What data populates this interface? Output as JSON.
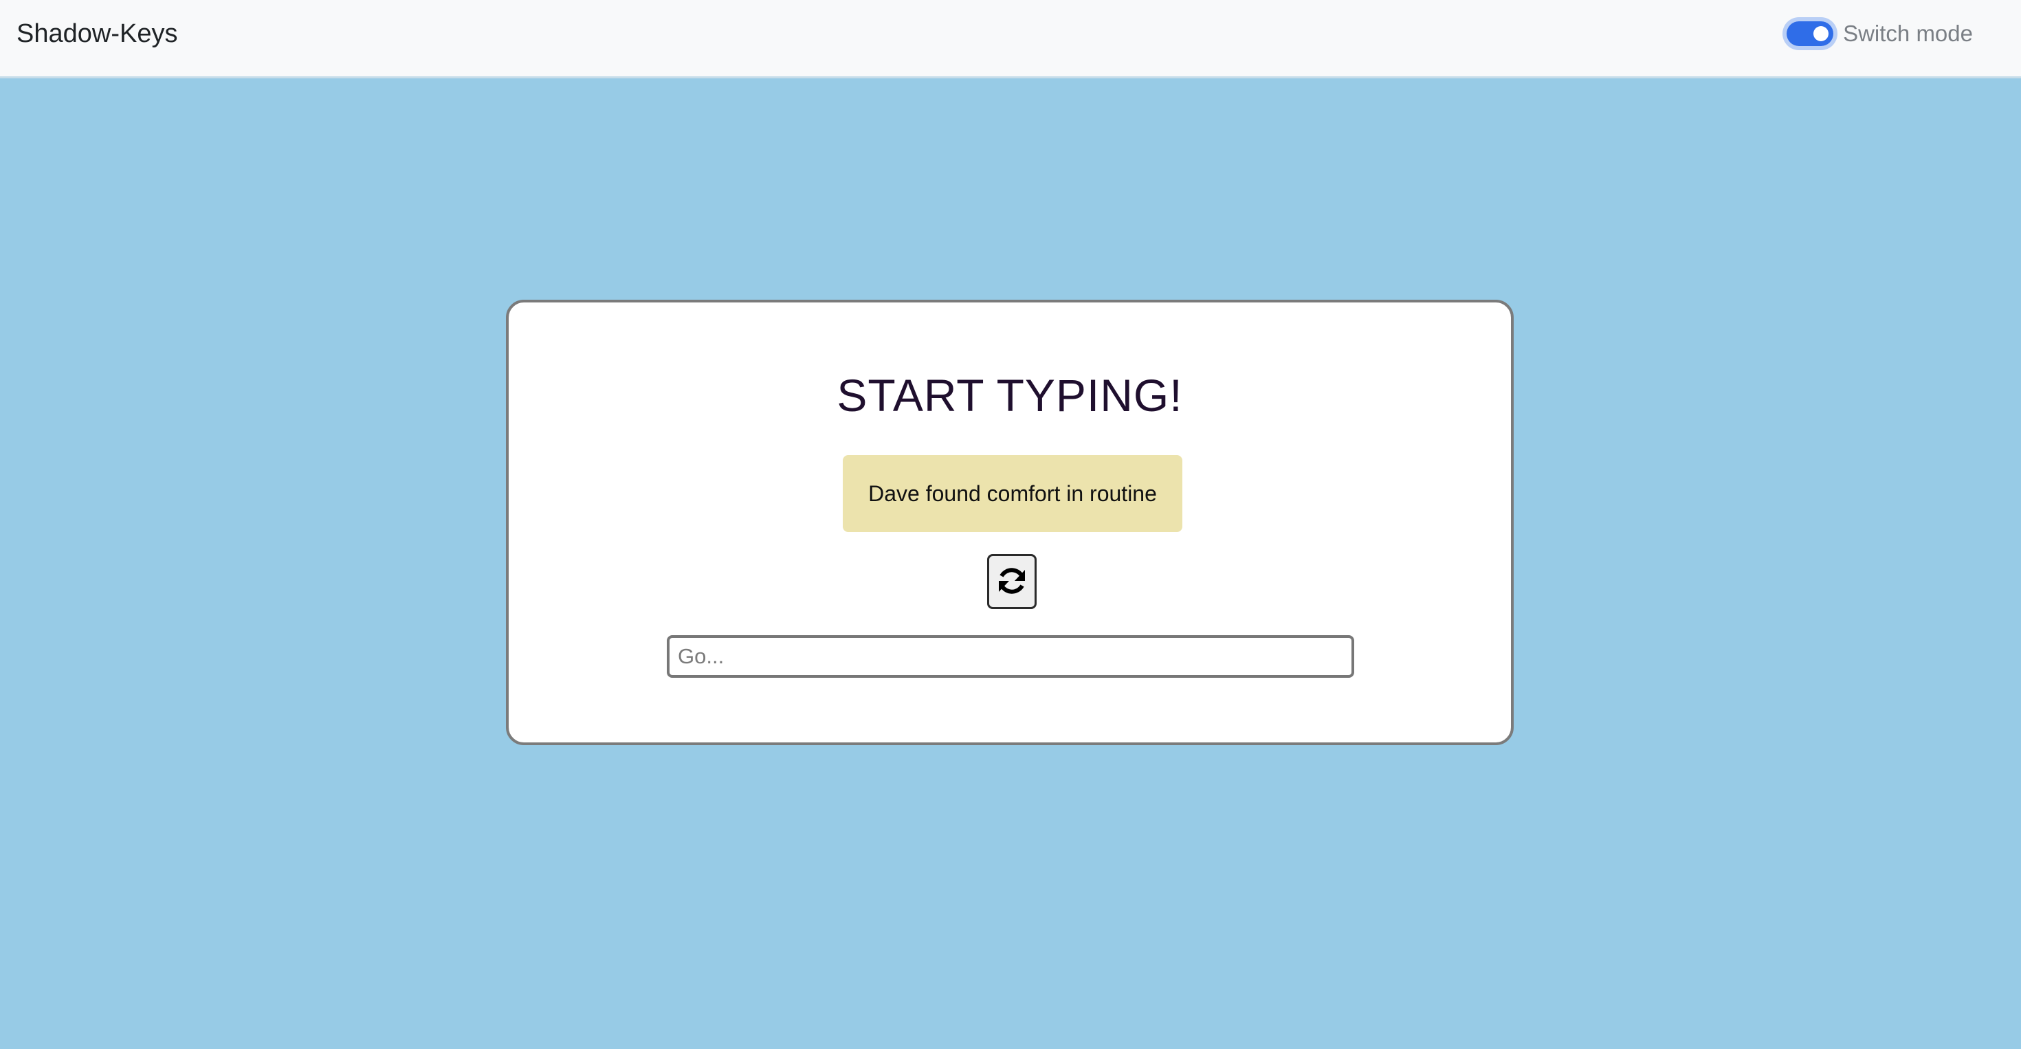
{
  "navbar": {
    "brand": "Shadow-Keys",
    "mode_switch": {
      "label": "Switch mode",
      "checked": true
    }
  },
  "typing_card": {
    "title": "START TYPING!",
    "prompt_text": "Dave found comfort in routine",
    "refresh_icon": "refresh-icon",
    "input": {
      "value": "",
      "placeholder": "Go..."
    }
  },
  "colors": {
    "page_background": "#97cbe6",
    "navbar_background": "#f8f9fa",
    "toggle_accent": "#2f6de8",
    "prompt_background": "#ece3ad",
    "title_color": "#1f0f2e"
  }
}
